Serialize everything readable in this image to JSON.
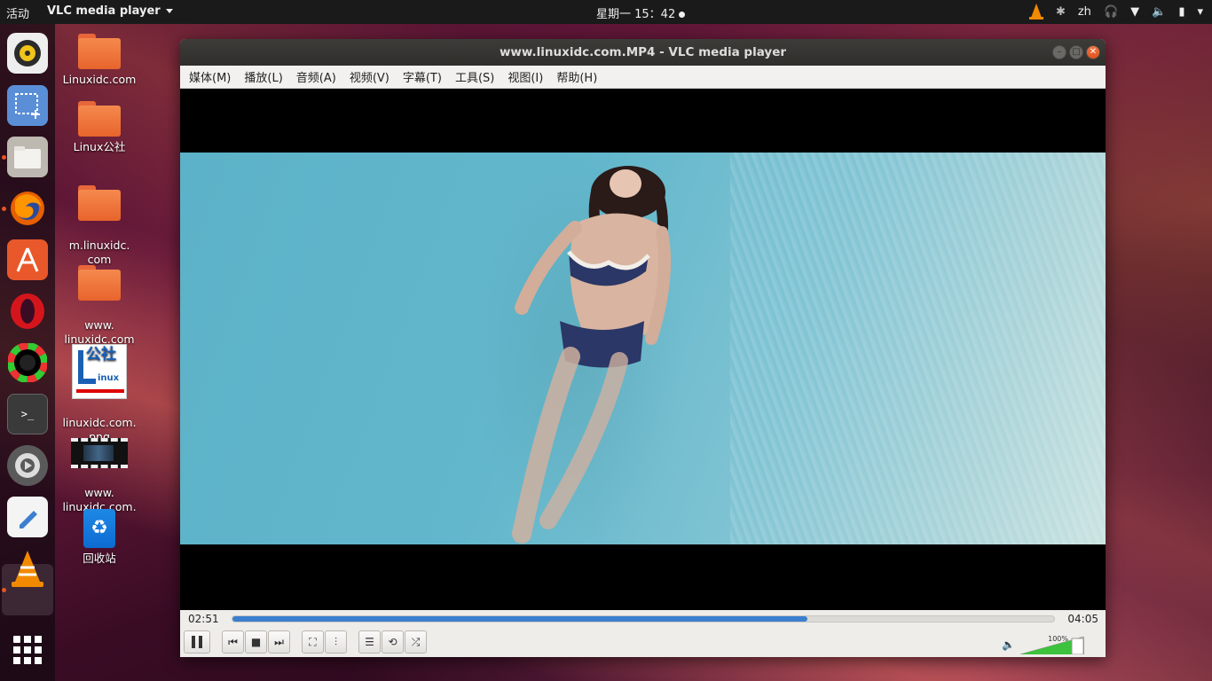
{
  "topbar": {
    "activities": "活动",
    "app_name": "VLC media player",
    "clock": "星期一 15：42",
    "lang": "zh"
  },
  "dock": {
    "items": [
      {
        "name": "rhythmbox-icon"
      },
      {
        "name": "screenshot-icon"
      },
      {
        "name": "files-icon"
      },
      {
        "name": "firefox-icon"
      },
      {
        "name": "ubuntu-software-icon"
      },
      {
        "name": "opera-icon"
      },
      {
        "name": "color-picker-icon"
      },
      {
        "name": "terminal-icon"
      },
      {
        "name": "settings-icon"
      },
      {
        "name": "text-editor-icon"
      },
      {
        "name": "vlc-icon"
      }
    ],
    "apps_grid": "show-applications-icon"
  },
  "desktop": {
    "icons": [
      {
        "label": "Linuxidc.com",
        "kind": "folder"
      },
      {
        "label": "Linux公社",
        "kind": "folder"
      },
      {
        "label": "m.linuxidc.\ncom",
        "kind": "folder"
      },
      {
        "label": "www.\nlinuxidc.com",
        "kind": "folder"
      },
      {
        "label": "linuxidc.com.\npng",
        "kind": "image"
      },
      {
        "label": "www.\nlinuxidc.com.\nmkv",
        "kind": "video"
      },
      {
        "label": "回收站",
        "kind": "trash"
      }
    ],
    "png_logo_text": "公社",
    "png_logo_sub": "inux"
  },
  "window": {
    "title": "www.linuxidc.com.MP4 - VLC media player",
    "menus": [
      "媒体(M)",
      "播放(L)",
      "音频(A)",
      "视频(V)",
      "字幕(T)",
      "工具(S)",
      "视图(I)",
      "帮助(H)"
    ]
  },
  "player": {
    "elapsed": "02:51",
    "total": "04:05",
    "progress": 0.7,
    "volume_label": "100%",
    "volume": 1.0,
    "accent": "#3b7fcf"
  }
}
